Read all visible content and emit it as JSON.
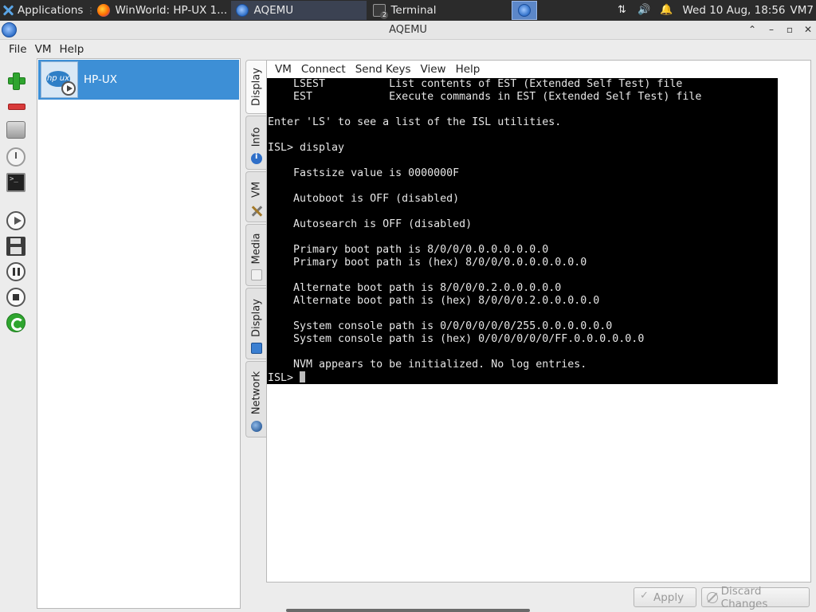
{
  "panel": {
    "applications_label": "Applications",
    "tasks": [
      {
        "label": "WinWorld: HP-UX 1..."
      },
      {
        "label": "AQEMU"
      },
      {
        "label": "Terminal"
      }
    ],
    "clock": "Wed 10 Aug, 18:56",
    "user_label": "VM7"
  },
  "window": {
    "title": "AQEMU"
  },
  "menubar": {
    "items": [
      {
        "label": "File"
      },
      {
        "label": "VM"
      },
      {
        "label": "Help"
      }
    ]
  },
  "toolbar_icons": [
    "add-icon",
    "delete-icon",
    "drive-icon",
    "clock-icon",
    "terminal-icon",
    "play-icon",
    "save-icon",
    "pause-icon",
    "stop-icon",
    "reset-icon"
  ],
  "vm_list": {
    "items": [
      {
        "name": "HP-UX",
        "logo_text": "hp ux"
      }
    ]
  },
  "tabs": [
    {
      "label": "Display",
      "icon": "none"
    },
    {
      "label": "Info",
      "icon": "info-icon"
    },
    {
      "label": "VM",
      "icon": "tools-icon"
    },
    {
      "label": "Media",
      "icon": "media-icon"
    },
    {
      "label": "Display",
      "icon": "display-icon"
    },
    {
      "label": "Network",
      "icon": "network-icon"
    }
  ],
  "vm_menu": {
    "items": [
      {
        "label": "VM"
      },
      {
        "label": "Connect"
      },
      {
        "label": "Send Keys"
      },
      {
        "label": "View"
      },
      {
        "label": "Help"
      }
    ]
  },
  "console": {
    "lines": [
      "    LSEST          List contents of EST (Extended Self Test) file",
      "    EST            Execute commands in EST (Extended Self Test) file",
      "",
      "Enter 'LS' to see a list of the ISL utilities.",
      "",
      "ISL> display",
      "",
      "    Fastsize value is 0000000F",
      "",
      "    Autoboot is OFF (disabled)",
      "",
      "    Autosearch is OFF (disabled)",
      "",
      "    Primary boot path is 8/0/0/0.0.0.0.0.0.0",
      "    Primary boot path is (hex) 8/0/0/0.0.0.0.0.0.0",
      "",
      "    Alternate boot path is 8/0/0/0.2.0.0.0.0.0",
      "    Alternate boot path is (hex) 8/0/0/0.2.0.0.0.0.0",
      "",
      "    System console path is 0/0/0/0/0/0/255.0.0.0.0.0.0",
      "    System console path is (hex) 0/0/0/0/0/0/FF.0.0.0.0.0.0",
      "",
      "    NVM appears to be initialized. No log entries."
    ],
    "prompt": "ISL> "
  },
  "buttons": {
    "apply": "Apply",
    "discard": "Discard Changes"
  }
}
